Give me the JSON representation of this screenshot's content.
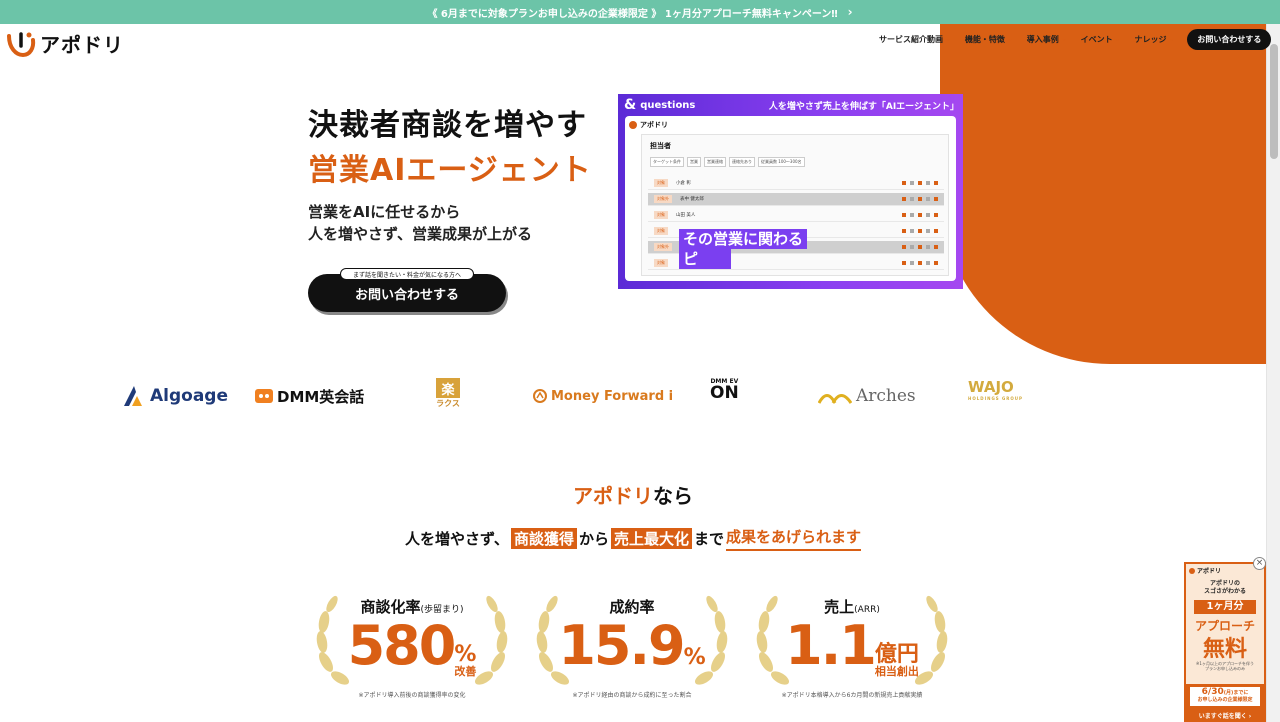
{
  "banner": {
    "text": "《 6月までに対象プランお申し込みの企業様限定 》 1ヶ月分アプローチ無料キャンペーン‼",
    "chevron": "›"
  },
  "header": {
    "logo_text": "アポドリ",
    "nav": [
      {
        "label": "サービス紹介動画"
      },
      {
        "label": "機能・特徴"
      },
      {
        "label": "導入事例"
      },
      {
        "label": "イベント"
      },
      {
        "label": "ナレッジ"
      }
    ],
    "cta_label": "お問い合わせする",
    "caret": "⌄"
  },
  "hero": {
    "title_line1": "決裁者商談を増やす",
    "title_line2": "営業AIエージェント",
    "sub_line1": "営業をAIに任せるから",
    "sub_line2": "人を増やさず、営業成果が上がる",
    "cta_badge": "まず話を聞きたい・料金が気になる方へ",
    "cta_label": "お問い合わせする"
  },
  "video": {
    "brand": "questions",
    "amp": "&",
    "headline": "人を増やさず売上を伸ばす「AIエージェント」",
    "app_logo": "アポドリ",
    "panel_title": "担当者",
    "filters": [
      "ターゲット条件",
      "営業",
      "営業連絡",
      "連絡先あり",
      "従業員数 100〜300名"
    ],
    "rows": [
      {
        "tag": "対象",
        "name": "小倉 彰",
        "gray": false
      },
      {
        "tag": "対象外",
        "name": "表中 健太郎",
        "gray": true
      },
      {
        "tag": "対象",
        "name": "山田 美人",
        "gray": false
      },
      {
        "tag": "対象",
        "name": "",
        "gray": false
      },
      {
        "tag": "対象外",
        "name": "",
        "gray": true
      },
      {
        "tag": "対象",
        "name": "",
        "gray": false
      }
    ],
    "caption_line1": "その営業に関わる",
    "caption_line2": "ピ"
  },
  "client_logos": {
    "algoage": "Algoage",
    "dmm": "DMM英会話",
    "raks_mark": "楽",
    "raks": "ラクス",
    "moneyforward": "Money Forward i",
    "dmm_ev_top": "DMM EV",
    "dmm_ev": "ON",
    "arches": "Arches",
    "wajo": "WAJO",
    "wajo_sub": "HOLDINGS GROUP"
  },
  "section": {
    "head_brand": "アポドリ",
    "head_rest": "なら",
    "sub_part1": "人を増やさず、",
    "sub_box1": "商談獲得",
    "sub_part2": "から",
    "sub_box2": "売上最大化",
    "sub_part3": "まで",
    "sub_underline": "成果をあげられます"
  },
  "stats": [
    {
      "label": "商談化率",
      "label_small": "(歩留まり)",
      "value": "580",
      "unit": "%",
      "unit_sub": "改善",
      "note": "※アポドリ導入前後の商談獲得率の変化"
    },
    {
      "label": "成約率",
      "label_small": "",
      "value": "15.9",
      "unit": "%",
      "unit_sub": "",
      "note": "※アポドリ経由の商談から成約に至った割合"
    },
    {
      "label": "売上",
      "label_small": "(ARR)",
      "value": "1.1",
      "unit": "億円",
      "unit_sub": "相当創出",
      "note": "※アポドリ本格導入から6カ月間の新規売上貢献実績"
    }
  ],
  "promo": {
    "close": "×",
    "logo": "アポドリ",
    "line1": "アポドリの",
    "line2": "スゴさがわかる",
    "month": "1ヶ月分",
    "approach": "アプローチ",
    "free": "無料",
    "fine1": "※1ヶ月以上のアプローチを伴う",
    "fine2": "プランお申し込みのみ",
    "date_big": "6/30",
    "date_rest": "(月)までに",
    "date_line2": "お申し込みの企業様限定",
    "talk": "いますぐ話を聞く ›"
  },
  "colors": {
    "accent": "#d95f14",
    "banner": "#6cc4a8",
    "dark": "#111111",
    "video_purple": "#7b3ff0"
  }
}
